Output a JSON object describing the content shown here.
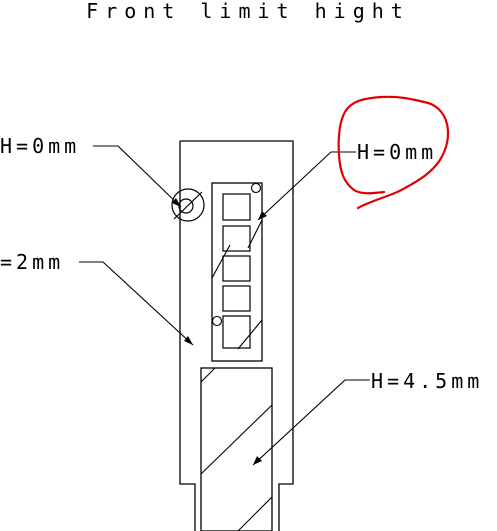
{
  "title": "Front limit hight",
  "labels": {
    "left_top": "H=0mm",
    "left_mid": "=2mm",
    "right_top": "H=0mm",
    "right_bottom": "H=4.5mm"
  },
  "colors": {
    "line": "#000000",
    "markup": "#e00000",
    "background": "#ffffff"
  }
}
